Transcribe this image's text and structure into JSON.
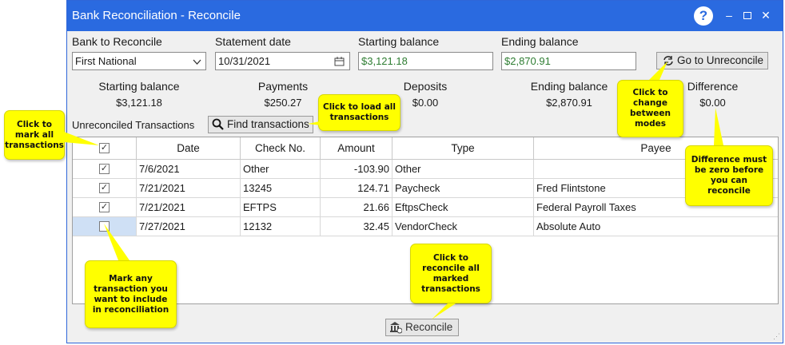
{
  "window": {
    "title": "Bank Reconciliation - Reconcile",
    "help": "?",
    "min": "–",
    "close": "✕"
  },
  "form": {
    "bank_label": "Bank to Reconcile",
    "bank_value": "First National",
    "date_label": "Statement date",
    "date_value": "10/31/2021",
    "start_label": "Starting balance",
    "start_value": "$3,121.18",
    "end_label": "Ending balance",
    "end_value": "$2,870.91",
    "unreconcile_button": "Go to Unreconcile"
  },
  "summary": {
    "starting_label": "Starting balance",
    "starting_value": "$3,121.18",
    "payments_label": "Payments",
    "payments_value": "$250.27",
    "deposits_label": "Deposits",
    "deposits_value": "$0.00",
    "ending_label": "Ending balance",
    "ending_value": "$2,870.91",
    "difference_label": "Difference",
    "difference_value": "$0.00"
  },
  "transactions": {
    "label": "Unreconciled Transactions",
    "find_button": "Find transactions",
    "columns": [
      "Date",
      "Check No.",
      "Amount",
      "Type",
      "Payee"
    ],
    "rows": [
      {
        "checked": true,
        "date": "7/6/2021",
        "check_no": "Other",
        "amount": "-103.90",
        "type": "Other",
        "payee": ""
      },
      {
        "checked": true,
        "date": "7/21/2021",
        "check_no": "13245",
        "amount": "124.71",
        "type": "Paycheck",
        "payee": "Fred Flintstone"
      },
      {
        "checked": true,
        "date": "7/21/2021",
        "check_no": "EFTPS",
        "amount": "21.66",
        "type": "EftpsCheck",
        "payee": "Federal Payroll Taxes"
      },
      {
        "checked": false,
        "date": "7/27/2021",
        "check_no": "12132",
        "amount": "32.45",
        "type": "VendorCheck",
        "payee": "Absolute Auto"
      }
    ]
  },
  "reconcile_button": "Reconcile",
  "callouts": {
    "mark_all": "Click to mark all transactions",
    "load_all": "Click to load all transactions",
    "modes": "Click to change between modes",
    "difference": "Difference must be zero before you can reconcile",
    "mark_any": "Mark any transaction you want to include in reconciliation",
    "reconcile": "Click to reconcile all marked transactions"
  },
  "colors": {
    "title_bar": "#2a6ae0",
    "callout": "#ffff00",
    "balance_text": "#2e7d32"
  }
}
